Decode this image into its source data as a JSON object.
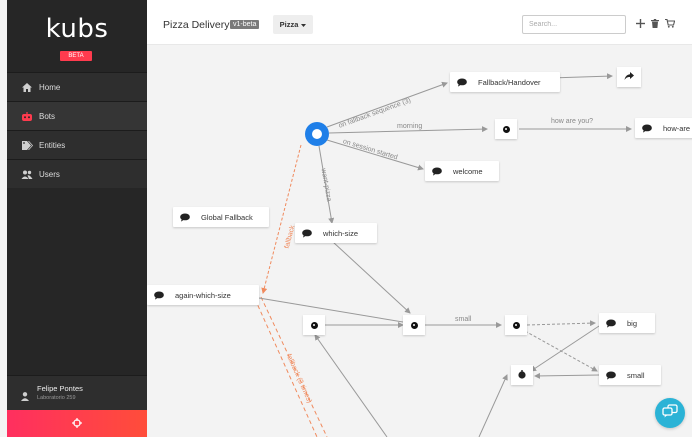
{
  "app": {
    "logo": "kubs",
    "badge": "BETA"
  },
  "nav": [
    {
      "label": "Home",
      "icon": "home-icon"
    },
    {
      "label": "Bots",
      "icon": "bot-icon",
      "active": true
    },
    {
      "label": "Entities",
      "icon": "tag-icon"
    },
    {
      "label": "Users",
      "icon": "users-icon"
    }
  ],
  "user": {
    "name": "Felipe Pontes",
    "org": "Laboratorio 259"
  },
  "header": {
    "title": "Pizza Delivery",
    "version": "v1-beta",
    "dropdown": "Pizza",
    "search_placeholder": "Search..."
  },
  "nodes": {
    "fallback_handover": "Fallback/Handover",
    "how_are": "how-are",
    "welcome": "welcome",
    "global_fallback": "Global Fallback",
    "which_size": "which-size",
    "again_which_size": "again-which-size",
    "big": "big",
    "small": "small"
  },
  "edges": {
    "on_fallback": "on fallback sequence (3)",
    "morning": "morning",
    "how_are_you": "how are you?",
    "on_session": "on session started",
    "want_pizza": "want-pizza",
    "small": "small",
    "fallback_orange1": "fallback",
    "fallback_orange2": "fallback (3 times)"
  },
  "colors": {
    "accent": "#1f7fe8",
    "brand": "#ff3b4e",
    "fallback_edge": "#f08a5d",
    "help": "#2bb3d6"
  }
}
